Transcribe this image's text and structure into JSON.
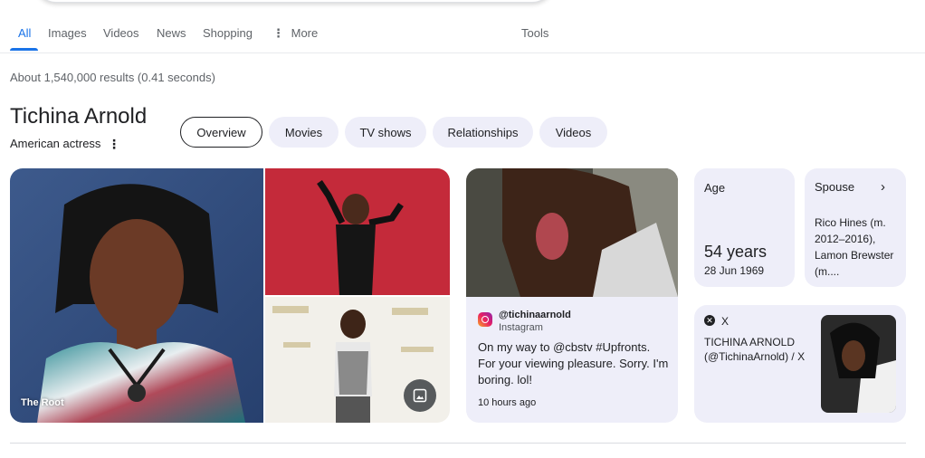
{
  "tabs": {
    "items": [
      "All",
      "Images",
      "Videos",
      "News",
      "Shopping",
      "More"
    ],
    "tools": "Tools"
  },
  "result_stats": "About 1,540,000 results (0.41 seconds)",
  "entity": {
    "title": "Tichina Arnold",
    "subtitle": "American actress",
    "chips": [
      "Overview",
      "Movies",
      "TV shows",
      "Relationships",
      "Videos"
    ],
    "image_caption": "The Root"
  },
  "instagram": {
    "handle": "@tichinaarnold",
    "source": "Instagram",
    "text": "On my way to @cbstv #Upfronts. For your viewing pleasure. Sorry. I'm boring. lol!",
    "time": "10 hours ago"
  },
  "age": {
    "label": "Age",
    "value": "54 years",
    "dob": "28 Jun 1969"
  },
  "spouse": {
    "label": "Spouse",
    "value": "Rico Hines (m. 2012–2016), Lamon Brewster (m...."
  },
  "x_card": {
    "source": "X",
    "text": "TICHINA ARNOLD (@TichinaArnold) / X"
  },
  "colors": {
    "accent": "#1a73e8",
    "chip_bg": "#eeeef9"
  }
}
